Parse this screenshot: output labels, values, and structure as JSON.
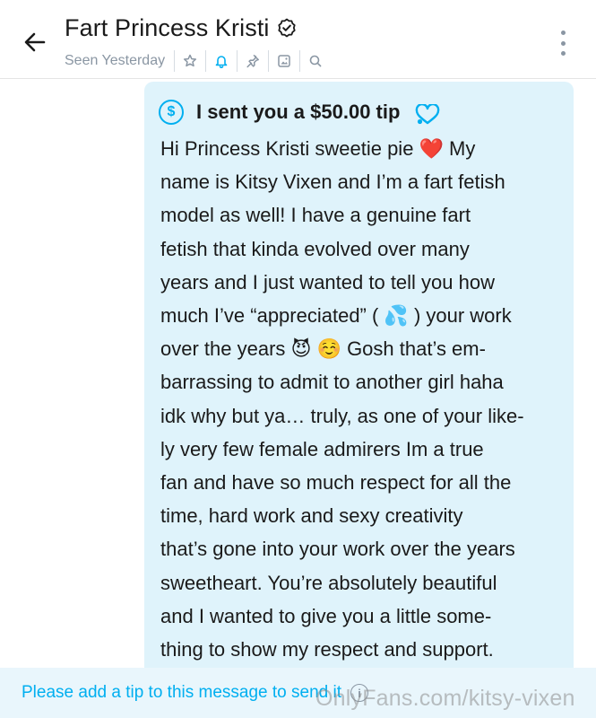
{
  "header": {
    "title": "Fart Princess Kristi",
    "status": "Seen Yesterday",
    "icons": [
      "back-arrow-icon",
      "verified-icon",
      "star-icon",
      "bell-icon",
      "pin-icon",
      "gallery-icon",
      "search-icon",
      "more-vertical-icon"
    ]
  },
  "message": {
    "tip_label": "I sent you a $50.00 tip",
    "tip_icon": "dollar-circle-icon",
    "lines": [
      "Hi Princess Kristi sweetie pie ❤️ My",
      "name is Kitsy Vixen and I’m a fart fetish",
      "model as well! I have a genuine fart",
      "fetish that kinda evolved over many",
      "years and I just wanted to tell you how",
      "much I’ve “appreciated” ( 💦 ) your work",
      "over the years 😈 ☺️ Gosh that’s em-",
      "barrassing to admit to another girl haha",
      "idk why but ya… truly, as one of your like-",
      "ly very few female admirers Im a true",
      "fan and have so much respect for all the",
      "time, hard work and sexy creativity",
      "that’s gone into your work over the years",
      "sweetheart. You’re absolutely beautiful",
      "and I wanted to give you a little some-",
      "thing to show my respect and support."
    ]
  },
  "footer": {
    "prompt": "Please add a tip to this message to send it"
  },
  "watermark": "OnlyFans.com/kitsy-vixen",
  "colors": {
    "accent": "#00aff0",
    "bubble": "#dff3fb",
    "muted": "#8a96a3"
  }
}
